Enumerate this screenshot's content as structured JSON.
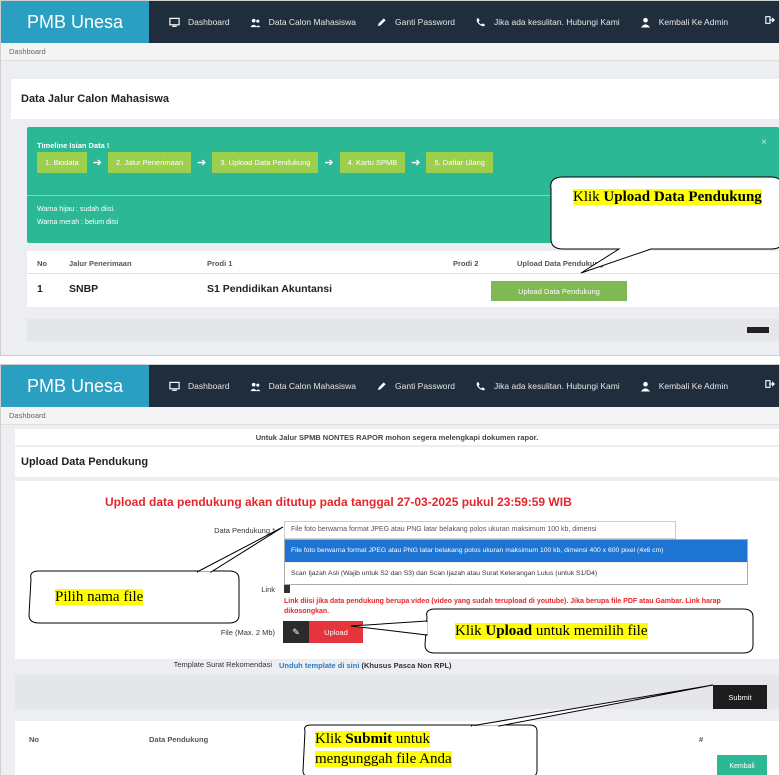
{
  "nav": {
    "brand": "PMB Unesa",
    "items": [
      {
        "label": "Dashboard",
        "icon": "monitor-icon"
      },
      {
        "label": "Data Calon Mahasiswa",
        "icon": "users-icon"
      },
      {
        "label": "Ganti Password",
        "icon": "pencil-icon"
      },
      {
        "label": "Jika ada kesulitan. Hubungi Kami",
        "icon": "phone-icon"
      },
      {
        "label": "Kembali Ke Admin",
        "icon": "user-icon"
      }
    ],
    "exit_icon": "sign-out-icon"
  },
  "breadcrumb": "Dashboard",
  "shot1": {
    "title": "Data Jalur Calon Mahasiswa",
    "timeline": {
      "heading": "Timeline Isian Data !",
      "steps": [
        "1. Biodata",
        "2. Jalur Penerimaan",
        "3. Upload Data Pendukung",
        "4. Kartu SPMB",
        "5. Daftar Ulang"
      ],
      "note_green": "Warna hijau : sudah diisi.",
      "note_red": "Warna merah : belum diisi",
      "close": "×",
      "color": "#2bb895"
    },
    "table": {
      "headers": [
        "No",
        "Jalur Penerimaan",
        "Prodi 1",
        "Prodi 2",
        "Upload Data Pendukung"
      ],
      "row": {
        "no": "1",
        "jalur": "SNBP",
        "prodi1": "S1 Pendidikan Akuntansi",
        "prodi2": ""
      }
    },
    "upload_button": "Upload Data Pendukung",
    "callout": {
      "pre": "Klik ",
      "bold": "Upload Data Pendukung"
    }
  },
  "shot2": {
    "notice": "Untuk Jalur SPMB NONTES RAPOR mohon segera melengkapi dokumen rapor.",
    "title": "Upload Data Pendukung",
    "deadline": "Upload data pendukung akan ditutup pada tanggal 27-03-2025 pukul 23:59:59 WIB",
    "labels": {
      "data_pendukung": "Data Pendukung *",
      "link": "Link",
      "file": "File (Max. 2 Mb)",
      "template": "Template Surat Rekomendasi"
    },
    "select_value": "File foto berwarna format JPEG atau PNG latar belakang polos ukuran maksimum 100 kb, dimensi",
    "dropdown_options": [
      "File foto berwarna format JPEG atau PNG latar belakang polos ukuran maksimum 100 kb, dimensi 400 x 600 pixel (4x6 cm)",
      "Scan Ijazah Asli (Wajib untuk S2 dan S3) dan Scan Ijazah atau Surat Keterangan Lulus (untuk S1/D4)"
    ],
    "link_note": "Link diisi jika data pendukung berupa video (video yang sudah terupload di youtube). Jika berupa file PDF atau Gambar. Link harap dikosongkan.",
    "upload_button": "Upload",
    "template_link": "Unduh template di sini",
    "template_note": " (Khusus Pasca Non RPL)",
    "submit_button": "Submit",
    "table_headers": [
      "No",
      "Data Pendukung",
      "#"
    ],
    "kembali_button": "Kembali",
    "callout_file": "Pilih nama file",
    "callout_upload": {
      "pre": "Klik ",
      "bold": "Upload",
      "post": " untuk memilih file"
    },
    "callout_submit": {
      "pre": "Klik ",
      "bold": "Submit",
      "post": " untuk",
      "line2": "mengunggah file Anda"
    },
    "error_color": "#e5262b"
  }
}
